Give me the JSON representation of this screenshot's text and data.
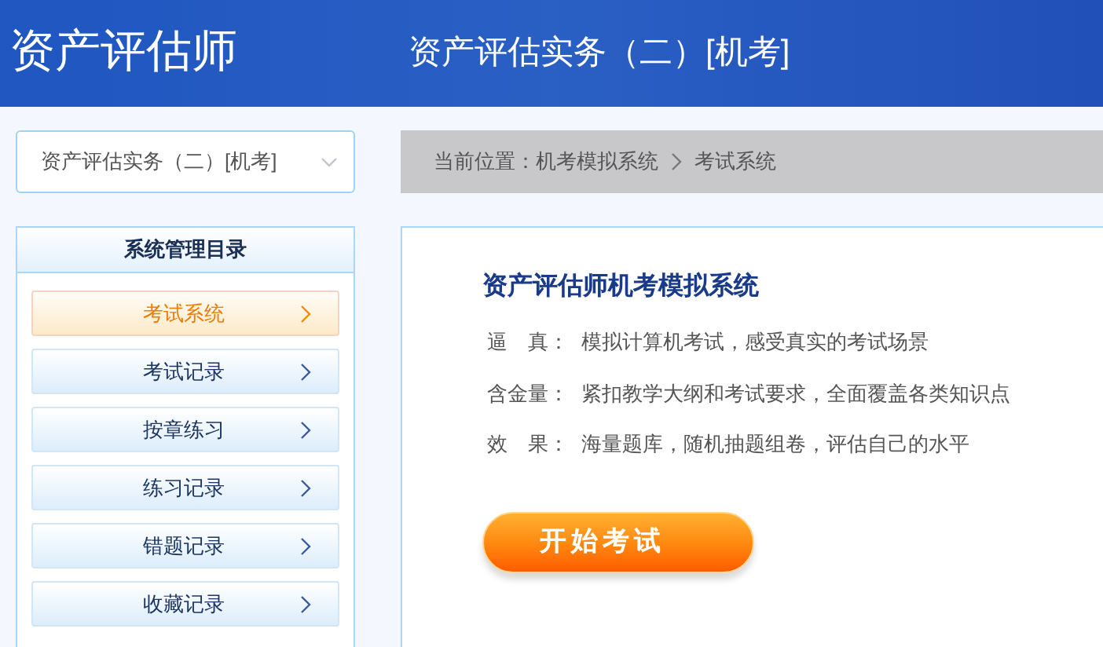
{
  "header": {
    "brand": "资产评估师",
    "subject": "资产评估实务（二）[机考]"
  },
  "subject_select": {
    "value": "资产评估实务（二）[机考]"
  },
  "breadcrumb": {
    "label": "当前位置：",
    "items": [
      "机考模拟系统",
      "考试系统"
    ]
  },
  "sidebar": {
    "title": "系统管理目录",
    "items": [
      {
        "label": "考试系统",
        "selected": true
      },
      {
        "label": "考试记录",
        "selected": false
      },
      {
        "label": "按章练习",
        "selected": false
      },
      {
        "label": "练习记录",
        "selected": false
      },
      {
        "label": "错题记录",
        "selected": false
      },
      {
        "label": "收藏记录",
        "selected": false
      }
    ]
  },
  "main": {
    "title": "资产评估师机考模拟系统",
    "features": [
      {
        "label": "逼　真：",
        "text": "模拟计算机考试，感受真实的考试场景"
      },
      {
        "label": "含金量：",
        "text": "紧扣教学大纲和考试要求，全面覆盖各类知识点"
      },
      {
        "label": "效　果：",
        "text": "海量题库，随机抽题组卷，评估自己的水平"
      }
    ],
    "start_button": "开始考试"
  }
}
